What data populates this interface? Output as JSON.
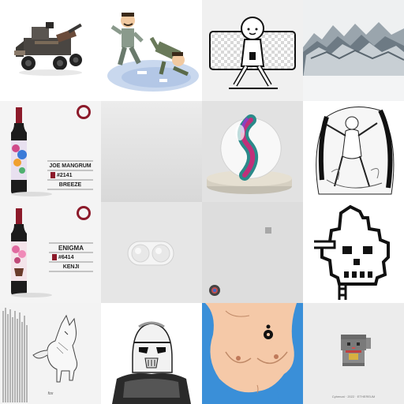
{
  "gallery": {
    "wine_1": {
      "name": "JOE MANGRUM",
      "number": "#2141",
      "edition": "BREEZE"
    },
    "wine_2": {
      "name": "ENIGMA",
      "number": "#6414",
      "edition": "KENJI"
    },
    "signature": "fox",
    "cat_caption": "Cybercat · 2022 · ETHEREUM"
  },
  "colors": {
    "wine_red": "#8c1a2a",
    "teal": "#2a8a8a",
    "magenta": "#c0307a",
    "blue_bg": "#3a8fd8",
    "skin": "#f5c9a8"
  }
}
